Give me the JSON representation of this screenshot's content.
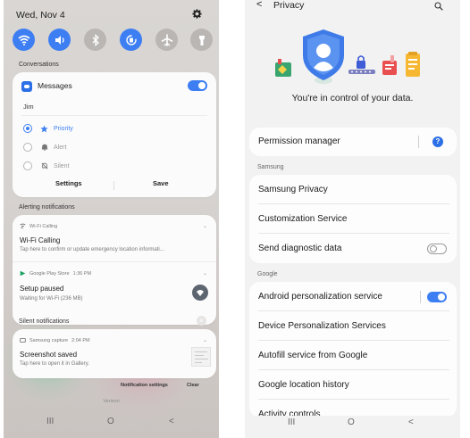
{
  "left_screen": {
    "date": "Wed, Nov 4",
    "quick_settings": [
      {
        "name": "wifi",
        "state": "on"
      },
      {
        "name": "sound",
        "state": "on"
      },
      {
        "name": "bluetooth",
        "state": "off"
      },
      {
        "name": "auto-rotate",
        "state": "on"
      },
      {
        "name": "airplane-mode",
        "state": "off"
      },
      {
        "name": "flashlight",
        "state": "off"
      }
    ],
    "conversations_label": "Conversations",
    "conversation_card": {
      "app_name": "Messages",
      "toggle": "on",
      "contact": "Jim",
      "options": [
        {
          "label": "Priority",
          "selected": true
        },
        {
          "label": "Alert",
          "selected": false
        },
        {
          "label": "Silent",
          "selected": false
        }
      ],
      "settings_label": "Settings",
      "save_label": "Save"
    },
    "alerting_label": "Alerting notifications",
    "wifi_notification": {
      "app": "Wi-Fi Calling",
      "title": "Wi-Fi Calling",
      "body": "Tap here to confirm or update emergency location informati..."
    },
    "play_notification": {
      "app": "Google Play Store",
      "time": "1:36 PM",
      "title": "Setup paused",
      "body": "Waiting for Wi-Fi (236 MB)"
    },
    "silent_label": "Silent notifications",
    "capture_notification": {
      "app": "Samsung capture",
      "time": "2:04 PM",
      "title": "Screenshot saved",
      "body": "Tap here to open it in Gallery."
    },
    "footer": {
      "notification_settings": "Notification settings",
      "clear": "Clear"
    },
    "carrier": "Verizon",
    "nav": {
      "recents": "III",
      "home": "O",
      "back": "<"
    }
  },
  "right_screen": {
    "back_glyph": "<",
    "title": "Privacy",
    "hero_caption": "You're in control of your data.",
    "permission_manager": "Permission manager",
    "samsung_label": "Samsung",
    "samsung_items": [
      "Samsung Privacy",
      "Customization Service",
      "Send diagnostic data"
    ],
    "send_diagnostic_toggle": "off",
    "google_label": "Google",
    "google_items": [
      "Android personalization service",
      "Device Personalization Services",
      "Autofill service from Google",
      "Google location history",
      "Activity controls"
    ],
    "android_personalization_toggle": "on",
    "nav": {
      "recents": "III",
      "home": "O",
      "back": "<"
    },
    "colors": {
      "accent": "#3d7ef2",
      "help_icon": "#2c6fe6"
    }
  }
}
